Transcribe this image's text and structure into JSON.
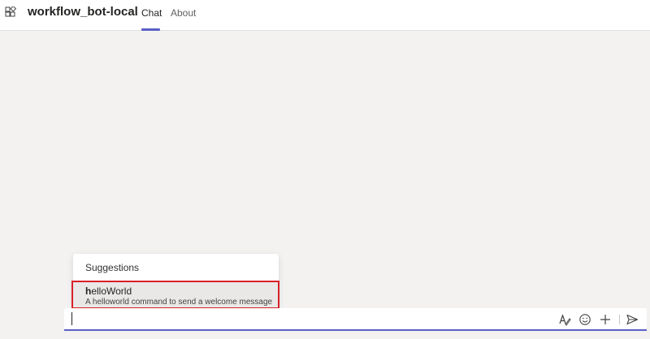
{
  "header": {
    "title": "workflow_bot-local",
    "tabs": [
      {
        "label": "Chat",
        "active": true
      },
      {
        "label": "About",
        "active": false
      }
    ]
  },
  "suggestions": {
    "title": "Suggestions",
    "items": [
      {
        "command_bold": "h",
        "command_rest": "elloWorld",
        "description": "A helloworld command to send a welcome message"
      }
    ]
  },
  "composer": {
    "value": "",
    "placeholder": ""
  },
  "icons": {
    "app": "apps-grid-icon",
    "format": "format-text-icon",
    "emoji": "emoji-icon",
    "add": "plus-icon",
    "send": "send-icon"
  },
  "colors": {
    "accent": "#5b5fc7",
    "highlight_border": "#d92028",
    "background": "#f3f2f1"
  }
}
